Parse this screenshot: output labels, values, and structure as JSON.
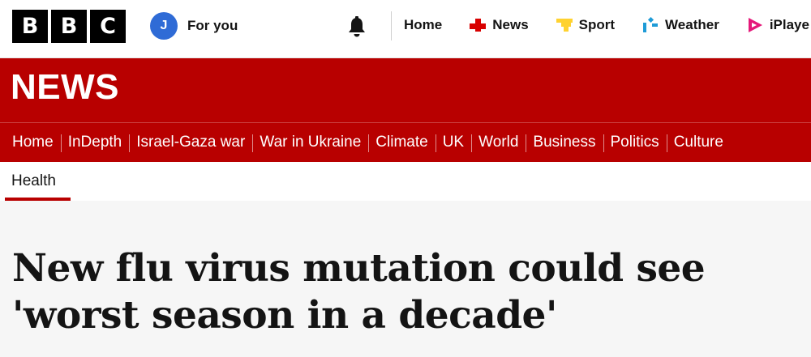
{
  "brand": {
    "letters": [
      "B",
      "B",
      "C"
    ]
  },
  "account": {
    "initial": "J",
    "label": "For you"
  },
  "global_nav": [
    {
      "label": "Home",
      "icon": "none"
    },
    {
      "label": "News",
      "icon": "news-icon",
      "color": "#d80000"
    },
    {
      "label": "Sport",
      "icon": "sport-icon",
      "color": "#ffd230"
    },
    {
      "label": "Weather",
      "icon": "weather-icon",
      "color": "#1e9bd7"
    },
    {
      "label": "iPlaye",
      "icon": "iplayer-icon",
      "color": "#e5197a"
    }
  ],
  "section": {
    "title": "NEWS"
  },
  "news_nav": [
    "Home",
    "InDepth",
    "Israel-Gaza war",
    "War in Ukraine",
    "Climate",
    "UK",
    "World",
    "Business",
    "Politics",
    "Culture"
  ],
  "sub_nav": {
    "active": "Health"
  },
  "article": {
    "headline": "New flu virus mutation could see 'worst season in a decade'"
  },
  "colors": {
    "brand_red": "#b80000",
    "avatar_blue": "#2f6bd6"
  }
}
